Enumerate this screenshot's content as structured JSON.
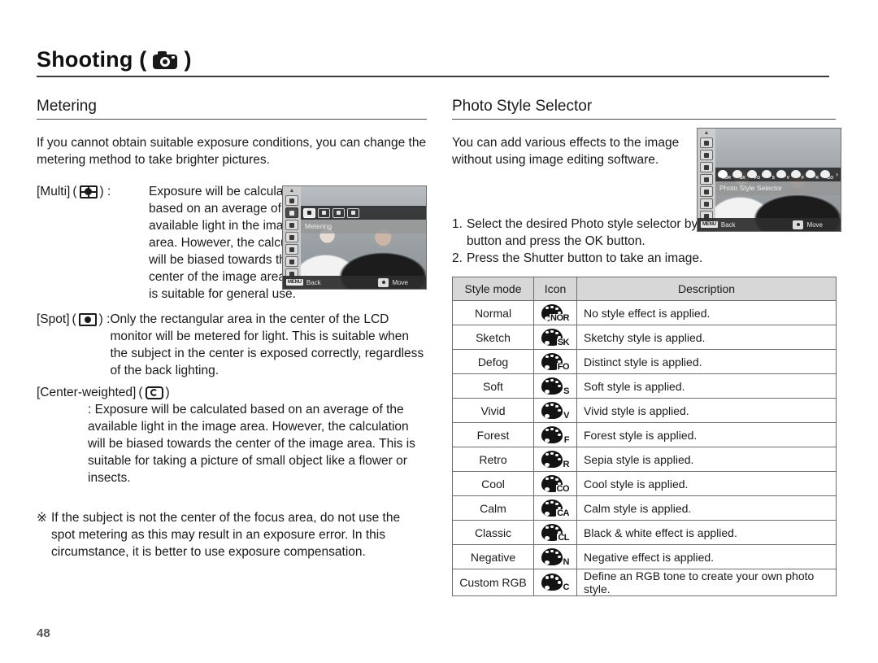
{
  "header": {
    "title": "Shooting (",
    "title_suffix": ")",
    "camera_icon": "camera-icon"
  },
  "page_number": "48",
  "left_column": {
    "section_title": "Metering",
    "intro": "If you cannot obtain suitable exposure conditions, you can change the metering method to take brighter pictures.",
    "modes": [
      {
        "label": "[Multi]",
        "icon": "metering-multi-icon",
        "colon": ") : ",
        "open": "(",
        "description": "Exposure will be calculated based on an average of the available light in the image area. However, the calculation will be biased towards the center of the image area. This is suitable for general use."
      },
      {
        "label": "[Spot]",
        "icon": "metering-spot-icon",
        "open": "(",
        "colon": ") : ",
        "description": "Only the rectangular area in the center of the LCD monitor will be metered for light. This is suitable when the subject in the center is exposed correctly, regardless of the back lighting."
      },
      {
        "label": "[Center-weighted]",
        "icon": "metering-center-weighted-icon",
        "open": "(",
        "colon": ")",
        "description": ": Exposure will be calculated based on an average of the available light in the image area. However, the calculation will be biased towards the center of the image area. This is suitable for taking a picture of small object like a flower or insects."
      }
    ],
    "note_marker": "※",
    "note": "If the subject is not the center of the focus area, do not use the spot metering as this may result in an exposure error. In this circumstance, it is better to use exposure compensation.",
    "lcd": {
      "menu_label": "Metering",
      "back_chip": "MENU",
      "back_label": "Back",
      "move_label": "Move",
      "mode_buttons": [
        "multi",
        "multi-alt",
        "spot",
        "center-weighted"
      ],
      "selected_index": 0
    }
  },
  "right_column": {
    "section_title": "Photo Style Selector",
    "intro": "You can add various effects to the image without using image editing software.",
    "steps": [
      {
        "num": "1.",
        "text": "Select the desired Photo style selector by pressing the Left/Right button and press the OK button."
      },
      {
        "num": "2.",
        "text": "Press the Shutter button to take an image."
      }
    ],
    "lcd": {
      "menu_label": "Photo Style Selector",
      "back_chip": "MENU",
      "back_label": "Back",
      "move_label": "Move",
      "palette_codes": [
        "NOR",
        "SK",
        "FO",
        "S",
        "V",
        "F",
        "R",
        "CO"
      ],
      "arrow": "›",
      "selected_index": 0
    },
    "table": {
      "columns": [
        "Style mode",
        "Icon",
        "Description"
      ],
      "rows": [
        {
          "mode": "Normal",
          "icon_code": "NOR",
          "icon_name": "style-normal-icon",
          "description": "No style effect is applied."
        },
        {
          "mode": "Sketch",
          "icon_code": "SK",
          "icon_name": "style-sketch-icon",
          "description": "Sketchy style is applied."
        },
        {
          "mode": "Defog",
          "icon_code": "FO",
          "icon_name": "style-defog-icon",
          "description": "Distinct style is applied."
        },
        {
          "mode": "Soft",
          "icon_code": "S",
          "icon_name": "style-soft-icon",
          "description": "Soft style is applied."
        },
        {
          "mode": "Vivid",
          "icon_code": "V",
          "icon_name": "style-vivid-icon",
          "description": "Vivid style is applied."
        },
        {
          "mode": "Forest",
          "icon_code": "F",
          "icon_name": "style-forest-icon",
          "description": "Forest style is applied."
        },
        {
          "mode": "Retro",
          "icon_code": "R",
          "icon_name": "style-retro-icon",
          "description": "Sepia style is applied."
        },
        {
          "mode": "Cool",
          "icon_code": "CO",
          "icon_name": "style-cool-icon",
          "description": "Cool style is applied."
        },
        {
          "mode": "Calm",
          "icon_code": "CA",
          "icon_name": "style-calm-icon",
          "description": "Calm style is applied."
        },
        {
          "mode": "Classic",
          "icon_code": "CL",
          "icon_name": "style-classic-icon",
          "description": "Black & white effect is applied."
        },
        {
          "mode": "Negative",
          "icon_code": "N",
          "icon_name": "style-negative-icon",
          "description": "Negative effect is applied."
        },
        {
          "mode": "Custom RGB",
          "icon_code": "C",
          "icon_name": "style-custom-rgb-icon",
          "description": "Define an RGB tone to create your own photo style."
        }
      ]
    }
  },
  "colors": {
    "text": "#1a1a1a",
    "rule": "#3a3a3a",
    "table_border": "#6d6d6d",
    "table_header_bg": "#d7d7d7",
    "page_number": "#555555"
  }
}
